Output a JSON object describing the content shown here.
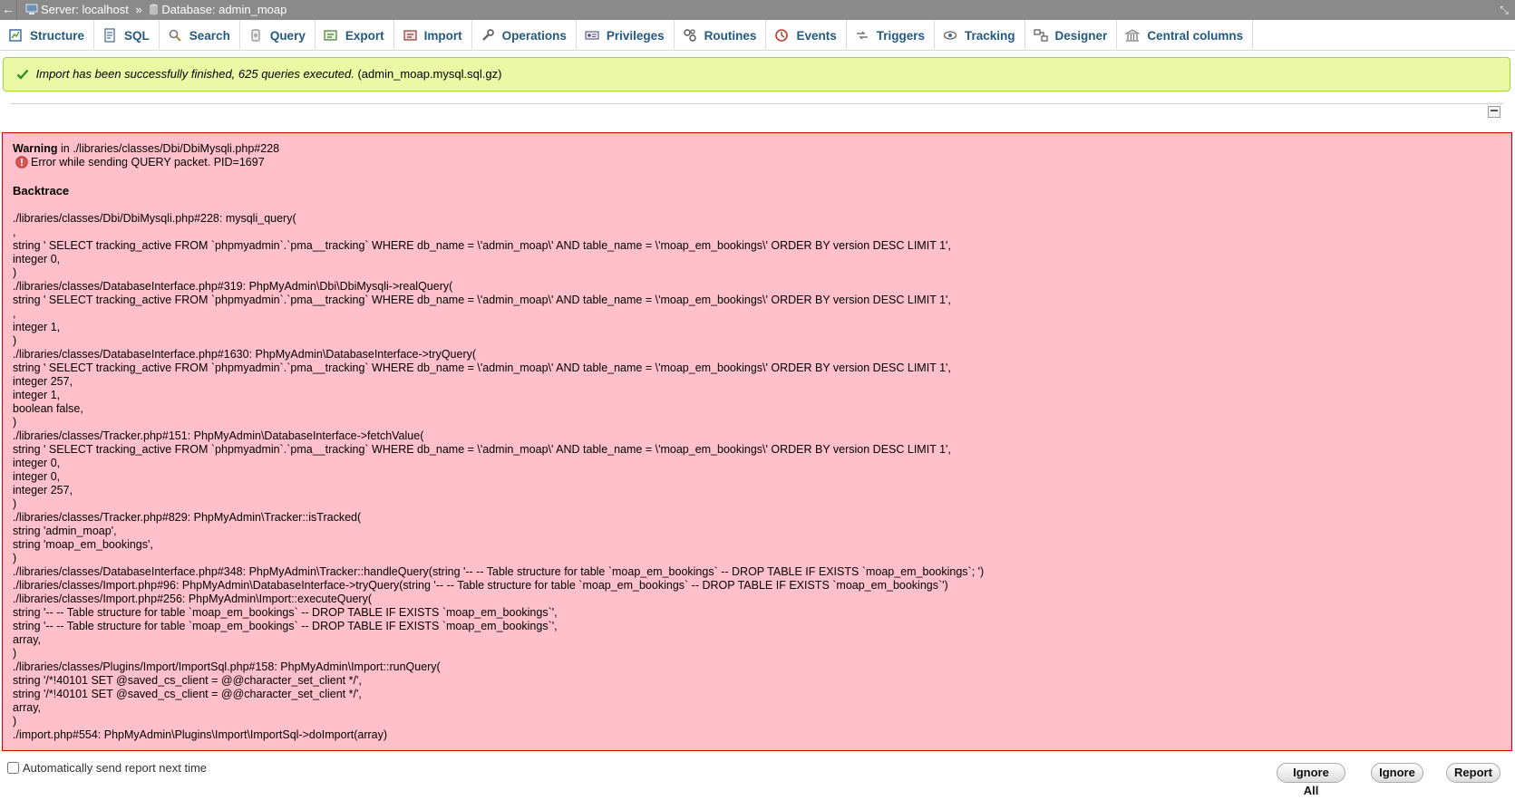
{
  "breadcrumb": {
    "back": "←",
    "server": "Server: localhost",
    "separator": "»",
    "database": "Database: admin_moap",
    "collapse": "⤡"
  },
  "tabs": [
    {
      "label": "Structure",
      "icon": "structure-icon"
    },
    {
      "label": "SQL",
      "icon": "sql-icon"
    },
    {
      "label": "Search",
      "icon": "search-icon"
    },
    {
      "label": "Query",
      "icon": "query-icon"
    },
    {
      "label": "Export",
      "icon": "export-icon"
    },
    {
      "label": "Import",
      "icon": "import-icon"
    },
    {
      "label": "Operations",
      "icon": "wrench-icon"
    },
    {
      "label": "Privileges",
      "icon": "privileges-icon"
    },
    {
      "label": "Routines",
      "icon": "routines-icon"
    },
    {
      "label": "Events",
      "icon": "events-icon"
    },
    {
      "label": "Triggers",
      "icon": "triggers-icon"
    },
    {
      "label": "Tracking",
      "icon": "eye-icon"
    },
    {
      "label": "Designer",
      "icon": "designer-icon"
    },
    {
      "label": "Central columns",
      "icon": "central-columns-icon"
    }
  ],
  "success": {
    "message": "Import has been successfully finished, 625 queries executed.",
    "file": "(admin_moap.mysql.sql.gz)"
  },
  "error": {
    "warning_label": "Warning",
    "warning_location": "in ./libraries/classes/Dbi/DbiMysqli.php#228",
    "error_message": "Error while sending QUERY packet. PID=1697",
    "backtrace_title": "Backtrace",
    "backtrace": [
      "./libraries/classes/Dbi/DbiMysqli.php#228: mysqli_query(",
      ",",
      "string ' SELECT tracking_active FROM `phpmyadmin`.`pma__tracking` WHERE db_name = \\'admin_moap\\' AND table_name = \\'moap_em_bookings\\' ORDER BY version DESC LIMIT 1',",
      "integer 0,",
      ")",
      "./libraries/classes/DatabaseInterface.php#319: PhpMyAdmin\\Dbi\\DbiMysqli->realQuery(",
      "string ' SELECT tracking_active FROM `phpmyadmin`.`pma__tracking` WHERE db_name = \\'admin_moap\\' AND table_name = \\'moap_em_bookings\\' ORDER BY version DESC LIMIT 1',",
      ",",
      "integer 1,",
      ")",
      "./libraries/classes/DatabaseInterface.php#1630: PhpMyAdmin\\DatabaseInterface->tryQuery(",
      "string ' SELECT tracking_active FROM `phpmyadmin`.`pma__tracking` WHERE db_name = \\'admin_moap\\' AND table_name = \\'moap_em_bookings\\' ORDER BY version DESC LIMIT 1',",
      "integer 257,",
      "integer 1,",
      "boolean false,",
      ")",
      "./libraries/classes/Tracker.php#151: PhpMyAdmin\\DatabaseInterface->fetchValue(",
      "string ' SELECT tracking_active FROM `phpmyadmin`.`pma__tracking` WHERE db_name = \\'admin_moap\\' AND table_name = \\'moap_em_bookings\\' ORDER BY version DESC LIMIT 1',",
      "integer 0,",
      "integer 0,",
      "integer 257,",
      ")",
      "./libraries/classes/Tracker.php#829: PhpMyAdmin\\Tracker::isTracked(",
      "string 'admin_moap',",
      "string 'moap_em_bookings',",
      ")",
      "./libraries/classes/DatabaseInterface.php#348: PhpMyAdmin\\Tracker::handleQuery(string '-- -- Table structure for table `moap_em_bookings` -- DROP TABLE IF EXISTS `moap_em_bookings`; ')",
      "./libraries/classes/Import.php#96: PhpMyAdmin\\DatabaseInterface->tryQuery(string '-- -- Table structure for table `moap_em_bookings` -- DROP TABLE IF EXISTS `moap_em_bookings`')",
      "./libraries/classes/Import.php#256: PhpMyAdmin\\Import::executeQuery(",
      "string '-- -- Table structure for table `moap_em_bookings` -- DROP TABLE IF EXISTS `moap_em_bookings`',",
      "string '-- -- Table structure for table `moap_em_bookings` -- DROP TABLE IF EXISTS `moap_em_bookings`',",
      "array,",
      ")",
      "./libraries/classes/Plugins/Import/ImportSql.php#158: PhpMyAdmin\\Import::runQuery(",
      "string '/*!40101 SET @saved_cs_client = @@character_set_client */',",
      "string '/*!40101 SET @saved_cs_client = @@character_set_client */',",
      "array,",
      ")",
      "./import.php#554: PhpMyAdmin\\Plugins\\Import\\ImportSql->doImport(array)"
    ]
  },
  "footer": {
    "auto_report_label": "Automatically send report next time",
    "ignore_all_label": "Ignore All",
    "ignore_label": "Ignore",
    "report_label": "Report"
  },
  "colors": {
    "topbar": "#8a8a8a",
    "tab_text": "#235a81",
    "success_bg": "#ebf8a4",
    "success_border": "#a2d246",
    "error_bg": "#ffc0cb",
    "error_border": "#cc0000"
  }
}
